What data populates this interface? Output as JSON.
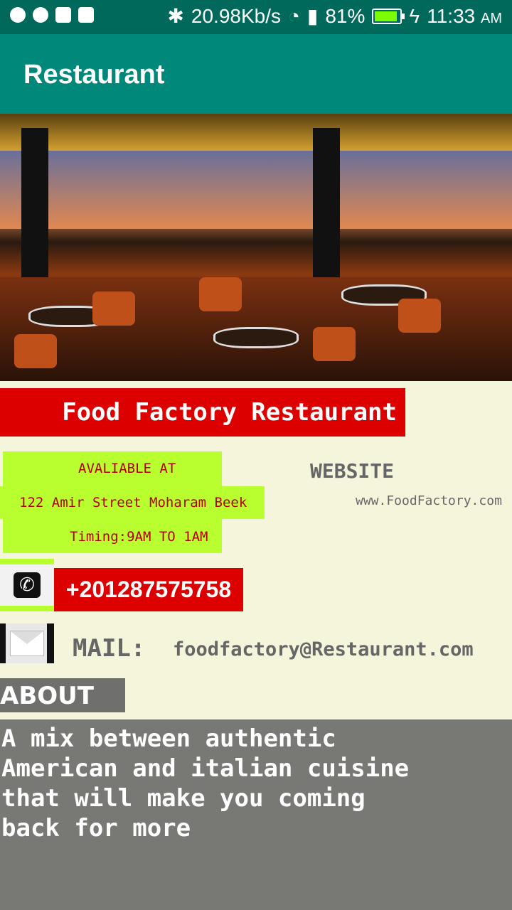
{
  "status_bar": {
    "network_speed": "20.98Kb/s",
    "battery": "81%",
    "time": "11:33",
    "ampm": "AM"
  },
  "app_bar": {
    "title": "Restaurant"
  },
  "restaurant": {
    "name": "Food Factory Restaurant",
    "available_label": "AVALIABLE AT",
    "address": "122 Amir Street Moharam Beek",
    "timing": "Timing:9AM TO 1AM",
    "website_label": "WEBSITE",
    "website_url": "www.FoodFactory.com",
    "phone": "+201287575758",
    "mail_label": "MAIL:",
    "mail_value": "foodfactory@Restaurant.com",
    "about_label": "ABOUT US",
    "about_text": "A mix between authentic\nAmerican and italian cuisine\nthat will make you coming\nback for more"
  }
}
